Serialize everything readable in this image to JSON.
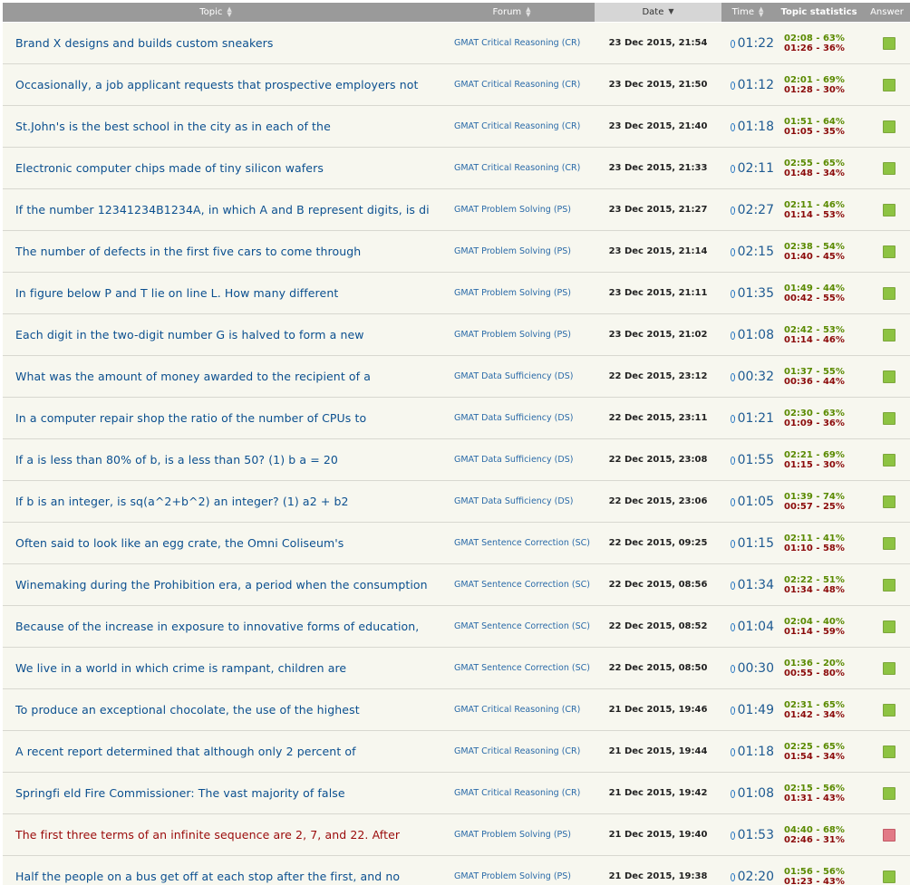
{
  "header": {
    "topic": "Topic",
    "forum": "Forum",
    "date": "Date",
    "time": "Time",
    "stats": "Topic statistics",
    "answer": "Answer"
  },
  "colors": {
    "correct": "#8dc342",
    "wrong": "#e27a86",
    "link": "#0b4f8f"
  },
  "rows": [
    {
      "topic": "Brand X designs and builds custom sneakers",
      "forum": "GMAT Critical Reasoning (CR)",
      "date": "23 Dec 2015, 21:54",
      "time": "01:22",
      "right": "02:08 - 63%",
      "wrong": "01:26 - 36%",
      "answer": "correct"
    },
    {
      "topic": "Occasionally, a job applicant requests that prospective employers not",
      "forum": "GMAT Critical Reasoning (CR)",
      "date": "23 Dec 2015, 21:50",
      "time": "01:12",
      "right": "02:01 - 69%",
      "wrong": "01:28 - 30%",
      "answer": "correct"
    },
    {
      "topic": "St.John's is the best school in the city as in each of the",
      "forum": "GMAT Critical Reasoning (CR)",
      "date": "23 Dec 2015, 21:40",
      "time": "01:18",
      "right": "01:51 - 64%",
      "wrong": "01:05 - 35%",
      "answer": "correct"
    },
    {
      "topic": "Electronic computer chips made of tiny silicon wafers",
      "forum": "GMAT Critical Reasoning (CR)",
      "date": "23 Dec 2015, 21:33",
      "time": "02:11",
      "right": "02:55 - 65%",
      "wrong": "01:48 - 34%",
      "answer": "correct"
    },
    {
      "topic": "If the number 12341234B1234A, in which A and B represent digits, is di",
      "forum": "GMAT Problem Solving (PS)",
      "date": "23 Dec 2015, 21:27",
      "time": "02:27",
      "right": "02:11 - 46%",
      "wrong": "01:14 - 53%",
      "answer": "correct"
    },
    {
      "topic": "The number of defects in the first five cars to come through",
      "forum": "GMAT Problem Solving (PS)",
      "date": "23 Dec 2015, 21:14",
      "time": "02:15",
      "right": "02:38 - 54%",
      "wrong": "01:40 - 45%",
      "answer": "correct"
    },
    {
      "topic": "In figure below P and T lie on line L. How many different",
      "forum": "GMAT Problem Solving (PS)",
      "date": "23 Dec 2015, 21:11",
      "time": "01:35",
      "right": "01:49 - 44%",
      "wrong": "00:42 - 55%",
      "answer": "correct"
    },
    {
      "topic": "Each digit in the two-digit number G is halved to form a new",
      "forum": "GMAT Problem Solving (PS)",
      "date": "23 Dec 2015, 21:02",
      "time": "01:08",
      "right": "02:42 - 53%",
      "wrong": "01:14 - 46%",
      "answer": "correct"
    },
    {
      "topic": "What was the amount of money awarded to the recipient of a",
      "forum": "GMAT Data Sufficiency (DS)",
      "date": "22 Dec 2015, 23:12",
      "time": "00:32",
      "right": "01:37 - 55%",
      "wrong": "00:36 - 44%",
      "answer": "correct"
    },
    {
      "topic": "In a computer repair shop the ratio of the number of CPUs to",
      "forum": "GMAT Data Sufficiency (DS)",
      "date": "22 Dec 2015, 23:11",
      "time": "01:21",
      "right": "02:30 - 63%",
      "wrong": "01:09 - 36%",
      "answer": "correct"
    },
    {
      "topic": "If a is less than 80% of b, is a less than 50? (1) b a = 20",
      "forum": "GMAT Data Sufficiency (DS)",
      "date": "22 Dec 2015, 23:08",
      "time": "01:55",
      "right": "02:21 - 69%",
      "wrong": "01:15 - 30%",
      "answer": "correct"
    },
    {
      "topic": "If b is an integer, is sq(a^2+b^2) an integer? (1) a2 + b2",
      "forum": "GMAT Data Sufficiency (DS)",
      "date": "22 Dec 2015, 23:06",
      "time": "01:05",
      "right": "01:39 - 74%",
      "wrong": "00:57 - 25%",
      "answer": "correct"
    },
    {
      "topic": "Often said to look like an egg crate, the Omni Coliseum's",
      "forum": "GMAT Sentence Correction (SC)",
      "date": "22 Dec 2015, 09:25",
      "time": "01:15",
      "right": "02:11 - 41%",
      "wrong": "01:10 - 58%",
      "answer": "correct"
    },
    {
      "topic": "Winemaking during the Prohibition era, a period when the consumption a",
      "forum": "GMAT Sentence Correction (SC)",
      "date": "22 Dec 2015, 08:56",
      "time": "01:34",
      "right": "02:22 - 51%",
      "wrong": "01:34 - 48%",
      "answer": "correct"
    },
    {
      "topic": "Because of the increase in exposure to innovative forms of education,",
      "forum": "GMAT Sentence Correction (SC)",
      "date": "22 Dec 2015, 08:52",
      "time": "01:04",
      "right": "02:04 - 40%",
      "wrong": "01:14 - 59%",
      "answer": "correct"
    },
    {
      "topic": "We live in a world in which crime is rampant, children are",
      "forum": "GMAT Sentence Correction (SC)",
      "date": "22 Dec 2015, 08:50",
      "time": "00:30",
      "right": "01:36 - 20%",
      "wrong": "00:55 - 80%",
      "answer": "correct"
    },
    {
      "topic": "To produce an exceptional chocolate, the use of the highest",
      "forum": "GMAT Critical Reasoning (CR)",
      "date": "21 Dec 2015, 19:46",
      "time": "01:49",
      "right": "02:31 - 65%",
      "wrong": "01:42 - 34%",
      "answer": "correct"
    },
    {
      "topic": "A recent report determined that although only 2 percent of",
      "forum": "GMAT Critical Reasoning (CR)",
      "date": "21 Dec 2015, 19:44",
      "time": "01:18",
      "right": "02:25 - 65%",
      "wrong": "01:54 - 34%",
      "answer": "correct"
    },
    {
      "topic": "Springfi eld Fire Commissioner: The vast majority of false",
      "forum": "GMAT Critical Reasoning (CR)",
      "date": "21 Dec 2015, 19:42",
      "time": "01:08",
      "right": "02:15 - 56%",
      "wrong": "01:31 - 43%",
      "answer": "correct"
    },
    {
      "topic": "The first three terms of an infinite sequence are 2, 7, and 22. After",
      "forum": "GMAT Problem Solving (PS)",
      "date": "21 Dec 2015, 19:40",
      "time": "01:53",
      "right": "04:40 - 68%",
      "wrong": "02:46 - 31%",
      "answer": "wrong"
    },
    {
      "topic": "Half the people on a bus get off at each stop after the first, and no",
      "forum": "GMAT Problem Solving (PS)",
      "date": "21 Dec 2015, 19:38",
      "time": "02:20",
      "right": "01:56 - 56%",
      "wrong": "01:23 - 43%",
      "answer": "correct"
    }
  ]
}
